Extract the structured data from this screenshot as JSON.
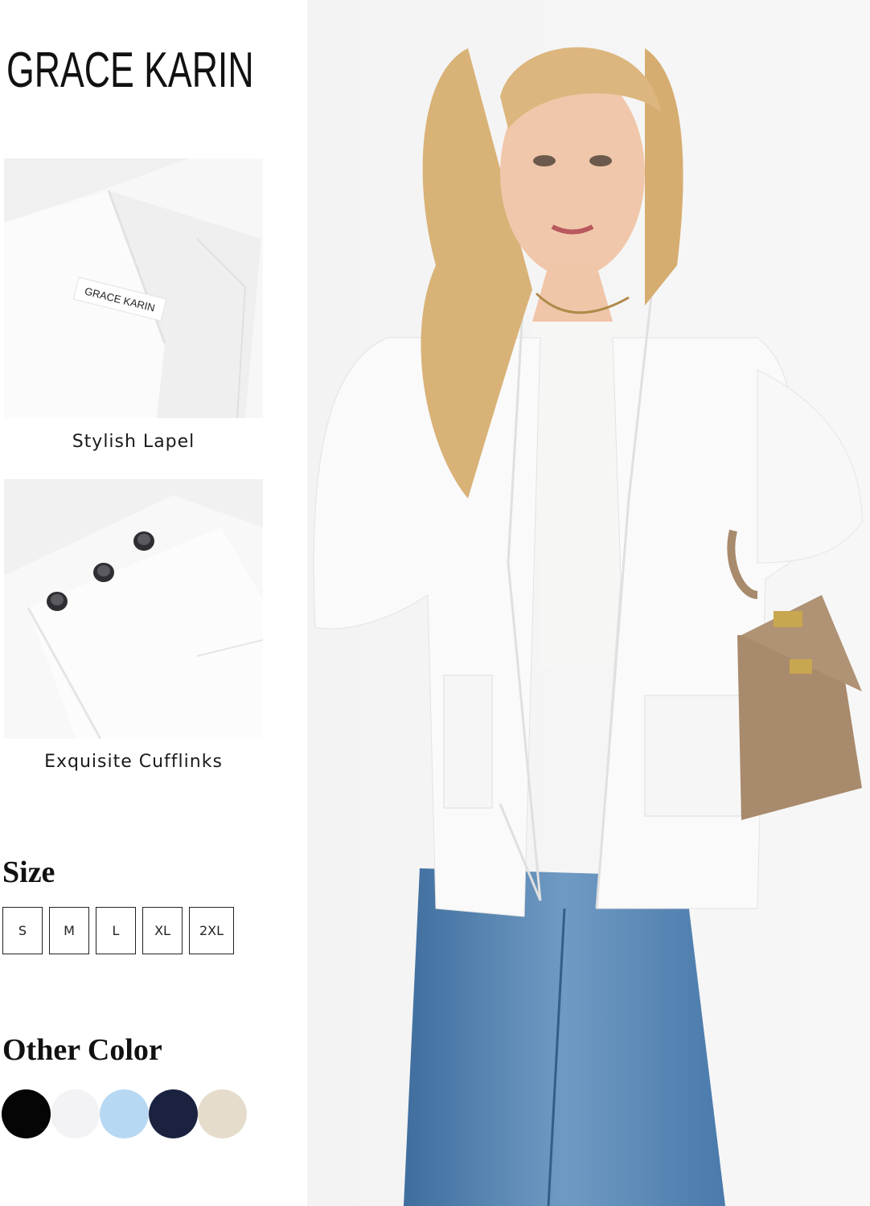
{
  "brand": {
    "name": "GRACE KARIN"
  },
  "details": [
    {
      "caption": "Stylish Lapel",
      "label_text": "GRACE KARIN"
    },
    {
      "caption": "Exquisite Cufflinks"
    }
  ],
  "size_section": {
    "heading": "Size",
    "options": [
      "S",
      "M",
      "L",
      "XL",
      "2XL"
    ]
  },
  "color_section": {
    "heading": "Other Color",
    "swatches": [
      {
        "name": "black",
        "hex": "#050505"
      },
      {
        "name": "white",
        "hex": "#f3f3f5"
      },
      {
        "name": "light-blue",
        "hex": "#b7d8f3"
      },
      {
        "name": "navy",
        "hex": "#1b2240"
      },
      {
        "name": "beige",
        "hex": "#e6dccb"
      }
    ]
  },
  "colors": {
    "text": "#111111",
    "cardigan": "#f7f7f7",
    "jeans": "#4f7fae",
    "bag": "#a88a6c",
    "hair": "#d9b277"
  }
}
